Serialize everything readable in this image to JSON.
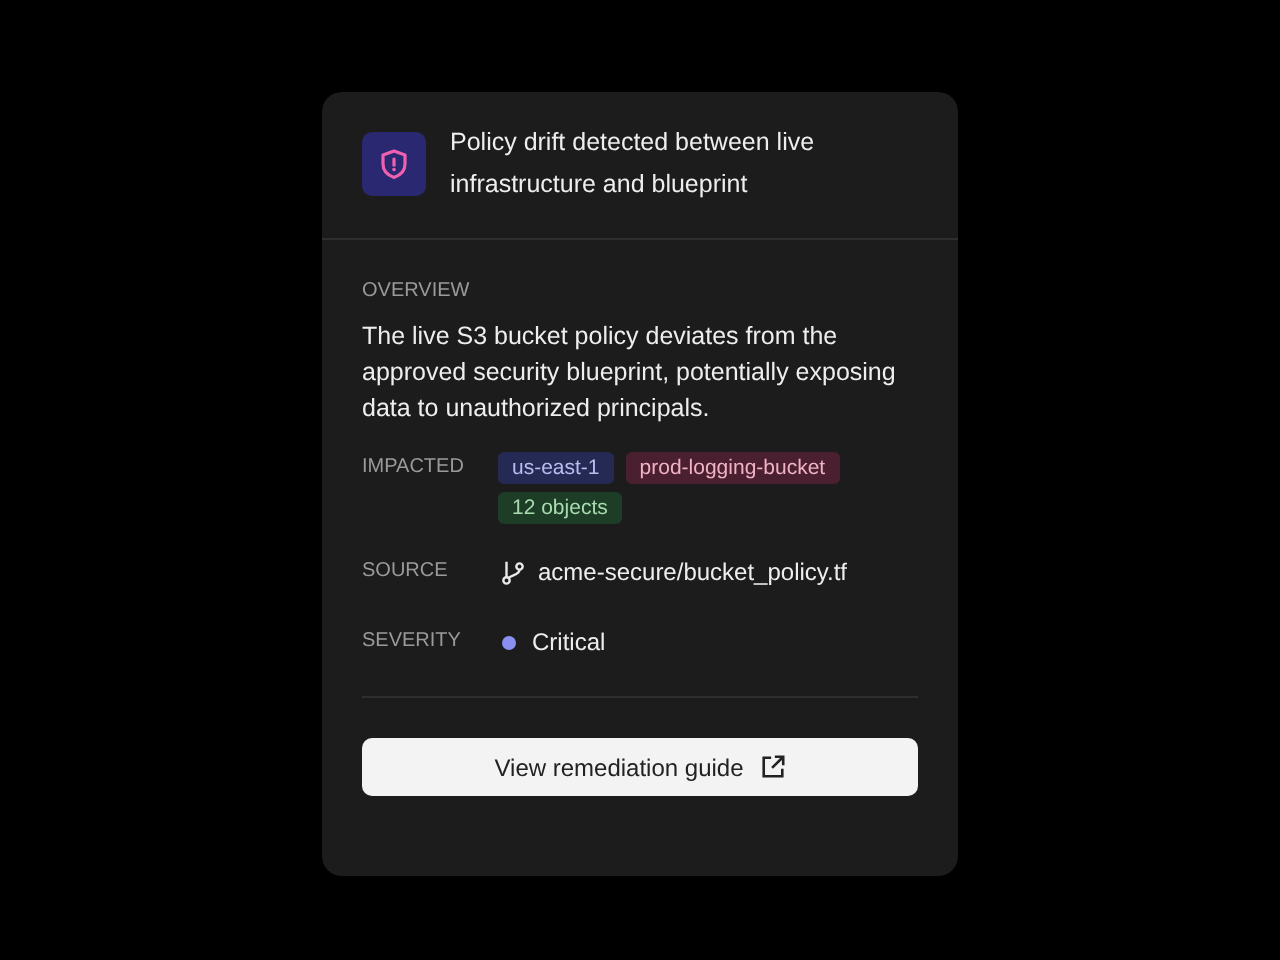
{
  "alert": {
    "title": "Policy drift detected between live infrastructure and blueprint"
  },
  "overview": {
    "label": "OVERVIEW",
    "text": "The live S3 bucket policy deviates from the approved security blueprint, potentially exposing data to unauthorized principals."
  },
  "impacted": {
    "label": "IMPACTED",
    "tags": [
      {
        "text": "us-east-1",
        "color": "#252a55"
      },
      {
        "text": "prod-logging-bucket",
        "color": "#4a1f30"
      },
      {
        "text": "12 objects",
        "color": "#1d3d26"
      }
    ]
  },
  "source": {
    "label": "SOURCE",
    "value": "acme-secure/bucket_policy.tf"
  },
  "severity": {
    "label": "SEVERITY",
    "value": "Critical"
  },
  "button": {
    "label": "View remediation guide"
  }
}
